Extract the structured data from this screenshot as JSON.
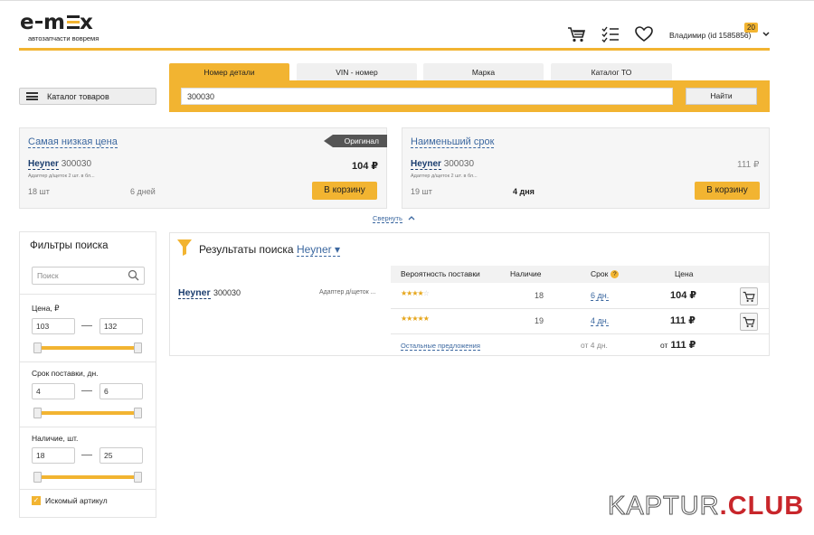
{
  "header": {
    "logo_text": "e‑m═ex",
    "slogan": "автозапчасти вовремя",
    "user_name": "Владимир  (id 1585856)",
    "notifications_count": "20",
    "icons": [
      "cart-icon",
      "checklist-icon",
      "heart-icon",
      "chevron-down-icon"
    ]
  },
  "catalog": {
    "label": "Каталог товаров"
  },
  "search": {
    "tabs": [
      {
        "label": "Номер детали",
        "active": true
      },
      {
        "label": "VIN - номер",
        "active": false
      },
      {
        "label": "Марка",
        "active": false
      },
      {
        "label": "Каталог ТО",
        "active": false
      }
    ],
    "query": "300030",
    "button": "Найти"
  },
  "best_offers": [
    {
      "title": "Самая низкая цена",
      "badge": "Оригинал",
      "brand": "Heyner",
      "article": "300030",
      "description": "Адаптер д/щеток 2 шт. в бл...",
      "qty": "18 шт",
      "term": "6 дней",
      "price": "104 ₽",
      "button": "В корзину"
    },
    {
      "title": "Наименьший срок",
      "brand": "Heyner",
      "article": "300030",
      "description": "Адаптер д/щеток 2 шт. в бл...",
      "qty": "19 шт",
      "term": "4 дня",
      "price": "111 ₽",
      "button": "В корзину"
    }
  ],
  "collapse_label": "Свернуть",
  "filters": {
    "title": "Фильтры поиска",
    "search_placeholder": "Поиск",
    "price": {
      "label": "Цена, ₽",
      "min": "103",
      "max": "132"
    },
    "term": {
      "label": "Срок поставки, дн.",
      "min": "4",
      "max": "6"
    },
    "stock": {
      "label": "Наличие, шт.",
      "min": "18",
      "max": "25"
    },
    "original_only": {
      "label": "Искомый артикул",
      "checked": true
    }
  },
  "results": {
    "title_prefix": "Результаты поиска",
    "brand": "Heyner",
    "columns": {
      "probability": "Вероятность поставки",
      "stock": "Наличие",
      "term": "Срок",
      "term_help": "?",
      "price": "Цена"
    },
    "item": {
      "brand": "Heyner",
      "article": "300030",
      "description": "Адаптер д/щеток ..."
    },
    "offers": [
      {
        "stars": 3.5,
        "stock": "18",
        "term": "6 дн.",
        "price": "104 ₽"
      },
      {
        "stars": 4.5,
        "stock": "19",
        "term": "4 дн.",
        "price": "111 ₽"
      }
    ],
    "other": {
      "label": "Остальные предложения",
      "term": "от 4 дн.",
      "price_prefix": "от",
      "price": "111 ₽"
    }
  },
  "watermark": {
    "part1": "KAPTUR",
    "part2": ".CLUB"
  },
  "colors": {
    "accent": "#f2b431",
    "link": "#3c68a0",
    "brand_link": "#1b3d6e",
    "watermark_red": "#c8262b"
  }
}
